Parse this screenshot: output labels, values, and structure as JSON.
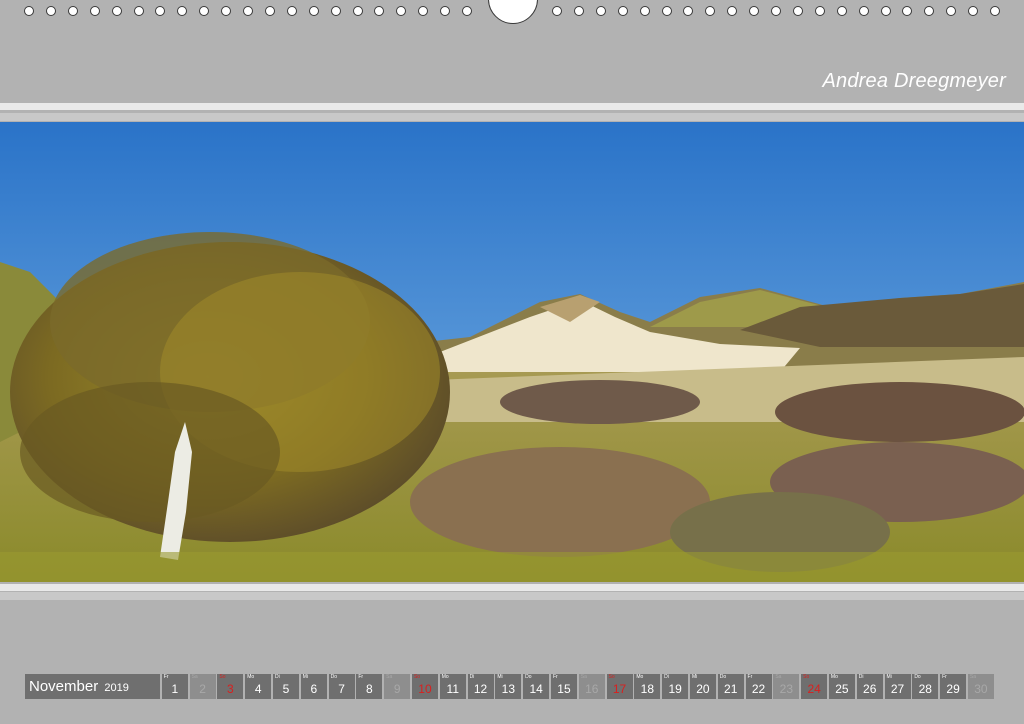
{
  "author": "Andrea Dreegmeyer",
  "calendar": {
    "month": "November",
    "year": "2019",
    "days": [
      {
        "n": "1",
        "d": "Fr",
        "t": "w"
      },
      {
        "n": "2",
        "d": "Sa",
        "t": "sat"
      },
      {
        "n": "3",
        "d": "So",
        "t": "sun"
      },
      {
        "n": "4",
        "d": "Mo",
        "t": "w"
      },
      {
        "n": "5",
        "d": "Di",
        "t": "w"
      },
      {
        "n": "6",
        "d": "Mi",
        "t": "w"
      },
      {
        "n": "7",
        "d": "Do",
        "t": "w"
      },
      {
        "n": "8",
        "d": "Fr",
        "t": "w"
      },
      {
        "n": "9",
        "d": "Sa",
        "t": "sat"
      },
      {
        "n": "10",
        "d": "So",
        "t": "sun"
      },
      {
        "n": "11",
        "d": "Mo",
        "t": "w"
      },
      {
        "n": "12",
        "d": "Di",
        "t": "w"
      },
      {
        "n": "13",
        "d": "Mi",
        "t": "w"
      },
      {
        "n": "14",
        "d": "Do",
        "t": "w"
      },
      {
        "n": "15",
        "d": "Fr",
        "t": "w"
      },
      {
        "n": "16",
        "d": "Sa",
        "t": "sat"
      },
      {
        "n": "17",
        "d": "So",
        "t": "sun"
      },
      {
        "n": "18",
        "d": "Mo",
        "t": "w"
      },
      {
        "n": "19",
        "d": "Di",
        "t": "w"
      },
      {
        "n": "20",
        "d": "Mi",
        "t": "w"
      },
      {
        "n": "21",
        "d": "Do",
        "t": "w"
      },
      {
        "n": "22",
        "d": "Fr",
        "t": "w"
      },
      {
        "n": "23",
        "d": "Sa",
        "t": "sat"
      },
      {
        "n": "24",
        "d": "So",
        "t": "sun"
      },
      {
        "n": "25",
        "d": "Mo",
        "t": "w"
      },
      {
        "n": "26",
        "d": "Di",
        "t": "w"
      },
      {
        "n": "27",
        "d": "Mi",
        "t": "w"
      },
      {
        "n": "28",
        "d": "Do",
        "t": "w"
      },
      {
        "n": "29",
        "d": "Fr",
        "t": "w"
      },
      {
        "n": "30",
        "d": "Sa",
        "t": "sat"
      }
    ]
  },
  "colors": {
    "page": "#b2b2b2",
    "cell": "#6f6f6f",
    "weekend_cell": "#8e8e8e",
    "sunday_text": "#d9201f"
  }
}
